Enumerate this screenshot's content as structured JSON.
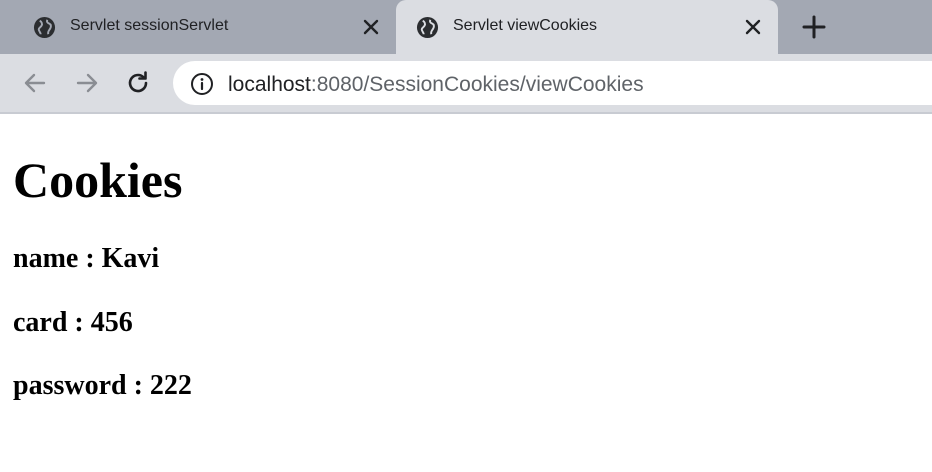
{
  "tabs": [
    {
      "title": "Servlet sessionServlet",
      "active": false
    },
    {
      "title": "Servlet viewCookies",
      "active": true
    }
  ],
  "address_bar": {
    "host": "localhost",
    "path": ":8080/SessionCookies/viewCookies"
  },
  "page": {
    "heading": "Cookies",
    "cookies": [
      "name : Kavi",
      "card : 456",
      "password : 222"
    ]
  },
  "icons": {
    "favicon": "globe-icon",
    "close": "close-icon",
    "new_tab": "plus-icon",
    "back": "back-arrow-icon",
    "forward": "forward-arrow-icon",
    "reload": "reload-icon",
    "site_info": "info-icon"
  }
}
